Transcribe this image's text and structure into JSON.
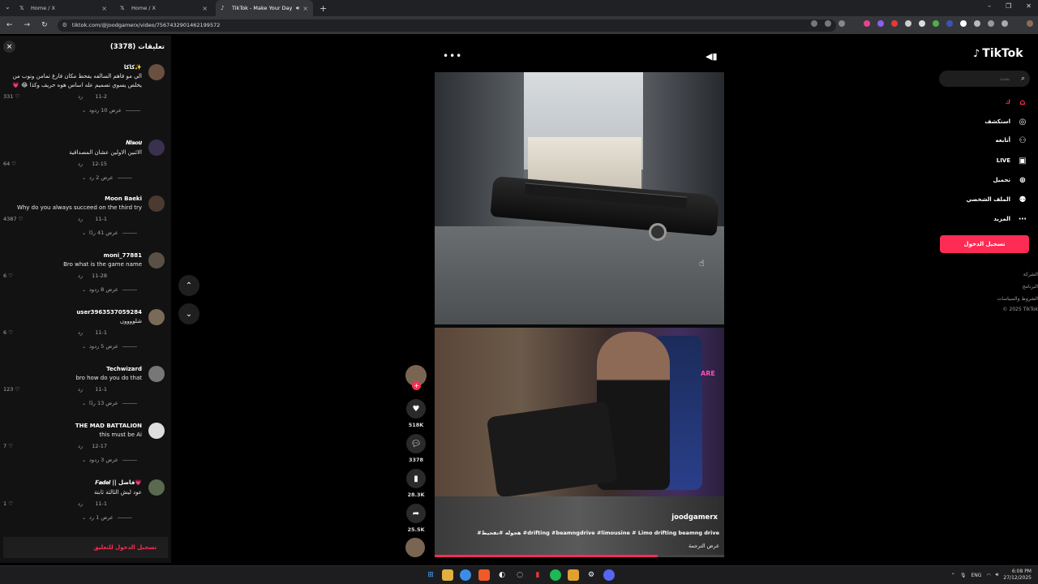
{
  "browser": {
    "tabs": [
      {
        "title": "Home / X",
        "icon": "x-logo-icon",
        "active": false
      },
      {
        "title": "Home / X",
        "icon": "x-logo-icon",
        "active": false
      },
      {
        "title": "TikTok - Make Your Day",
        "icon": "tiktok-icon",
        "active": true
      }
    ],
    "new_tab": "+",
    "url": "tiktok.com/@joodgamerx/video/7567432901462199572"
  },
  "comments_panel": {
    "title": "تعليقات (3378)",
    "close_label": "×",
    "login_prompt": "تسجيل الدخول للتعليق",
    "reply_label": "رد",
    "items": [
      {
        "user": "كاكا✨",
        "text": "الي مو فاهم السالفه يفحط مكان فارغ تمامن ونوب من يخلص يسوي تصميم عله اساس هوه حريف وكذا 😂 💗",
        "date": "11-2",
        "likes": "331",
        "replies": "عرض 10 ردود"
      },
      {
        "user": "𝑵𝒊𝒔𝒐𝒖",
        "text": "الاثنين الاولين عشان المصداقية",
        "date": "12-15",
        "likes": "64",
        "replies": "عرض 2 رد"
      },
      {
        "user": "Moon Baeki",
        "text": "Why do you always succeed on the third try",
        "date": "11-1",
        "likes": "4387",
        "replies": "عرض 41 ردًا"
      },
      {
        "user": "moni_77881",
        "text": "Bro what is the game name",
        "date": "11-28",
        "likes": "6",
        "replies": "عرض 8 ردود"
      },
      {
        "user": "user3963537059284",
        "text": "شلووووں",
        "date": "11-1",
        "likes": "6",
        "replies": "عرض 5 ردود"
      },
      {
        "user": "Techwizard",
        "text": "bro how do you do that",
        "date": "11-1",
        "likes": "123",
        "replies": "عرض 13 ردًا"
      },
      {
        "user": "THE MAD BATTALION",
        "text": "this must be Ai",
        "date": "12-17",
        "likes": "7",
        "replies": "عرض 3 ردود"
      },
      {
        "user": "𝑭𝒂𝒅𝒆𝒍 || فاضل💗",
        "text": "عود ليش الثالثة ثابتة",
        "date": "11-1",
        "likes": "1",
        "replies": "عرض 1 رد"
      }
    ]
  },
  "video": {
    "author": "joodgamerx",
    "description": "#هجوله #تفحيط #drifting #beamngdrive #limousine # Limo drifting  beamng drive",
    "translate_label": "عرض الترجمة",
    "neon_text": "ARE",
    "progress": 0.77,
    "more_label": "•••"
  },
  "actions": {
    "likes": "518K",
    "comments": "3378",
    "saves": "28.3K",
    "shares": "25.5K"
  },
  "sidebar": {
    "logo": "TikTok",
    "search_placeholder": "بحث",
    "menu": [
      {
        "label": "ك",
        "icon": "home-icon",
        "active": true
      },
      {
        "label": "استكشف",
        "icon": "compass-icon",
        "active": false
      },
      {
        "label": "أتابعه",
        "icon": "following-icon",
        "active": false
      },
      {
        "label": "LIVE",
        "icon": "live-icon",
        "active": false
      },
      {
        "label": "تحميل",
        "icon": "upload-icon",
        "active": false
      },
      {
        "label": "الملف الشخصي",
        "icon": "profile-icon",
        "active": false
      },
      {
        "label": "المزيد",
        "icon": "more-icon",
        "active": false
      }
    ],
    "login_button": "تسجيل الدخول",
    "footer": [
      "الشركة",
      "البرنامج",
      "الشروط والسياسات",
      "© 2025 TikTok"
    ]
  },
  "taskbar": {
    "lang": "ENG",
    "time": "6:08 PM",
    "date": "27/12/2025"
  },
  "colors": {
    "accent": "#fe2c55",
    "panel": "#121212",
    "chrome": "#35363a"
  }
}
